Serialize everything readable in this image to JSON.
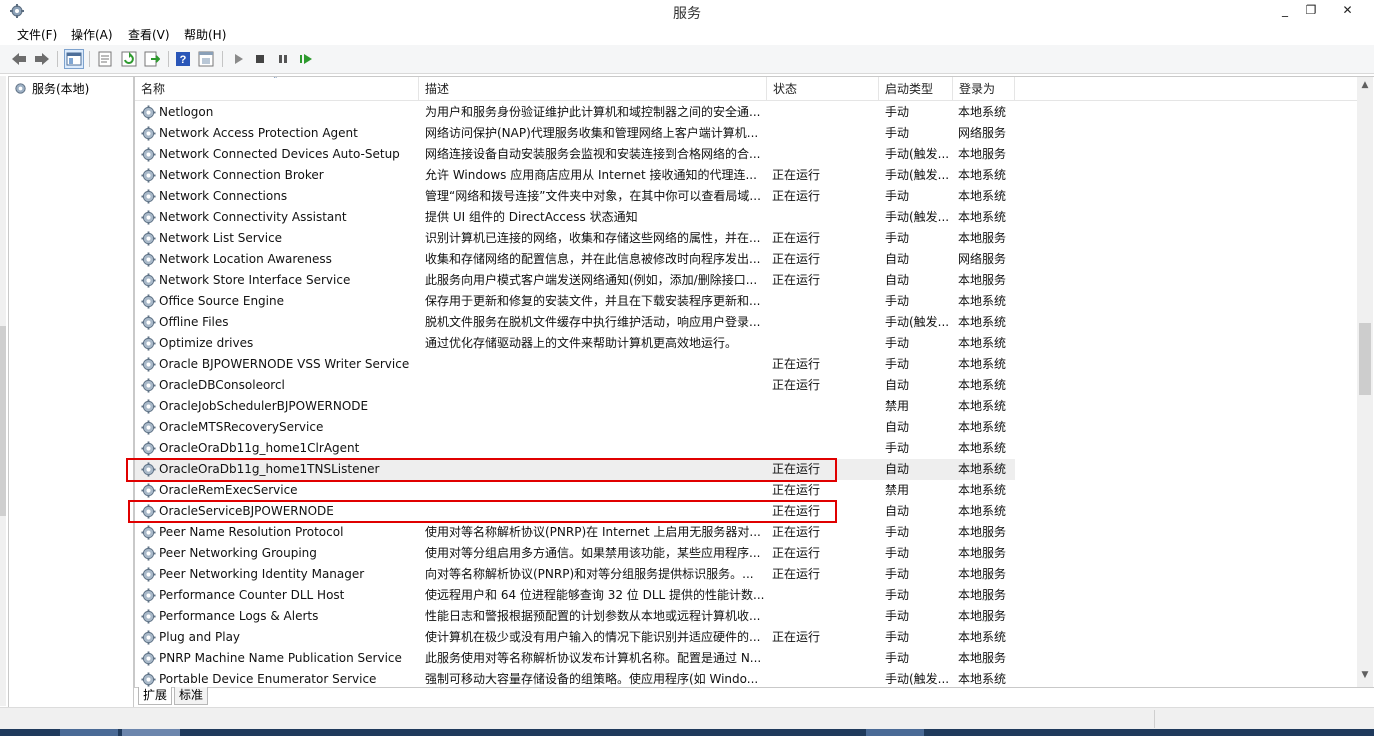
{
  "window": {
    "title": "服务",
    "minimize": "_",
    "maximize": "❐",
    "close": "✕"
  },
  "menu": [
    {
      "label": "文件(F)"
    },
    {
      "label": "操作(A)"
    },
    {
      "label": "查看(V)"
    },
    {
      "label": "帮助(H)"
    }
  ],
  "toolbar_icons": [
    "back-icon",
    "forward-icon",
    "show-console-tree-icon",
    "properties-icon",
    "refresh-icon",
    "export-list-icon",
    "help-icon",
    "view-icon",
    "start-service-icon",
    "stop-service-icon",
    "pause-service-icon",
    "restart-service-icon"
  ],
  "tree": {
    "root_label": "服务(本地)"
  },
  "columns": {
    "name": "名称",
    "description": "描述",
    "status": "状态",
    "startup": "启动类型",
    "logon": "登录为"
  },
  "services": [
    {
      "name": "Netlogon",
      "description": "为用户和服务身份验证维护此计算机和域控制器之间的安全通...",
      "status": "",
      "startup": "手动",
      "logon": "本地系统"
    },
    {
      "name": "Network Access Protection Agent",
      "description": "网络访问保护(NAP)代理服务收集和管理网络上客户端计算机...",
      "status": "",
      "startup": "手动",
      "logon": "网络服务"
    },
    {
      "name": "Network Connected Devices Auto-Setup",
      "description": "网络连接设备自动安装服务会监视和安装连接到合格网络的合...",
      "status": "",
      "startup": "手动(触发...",
      "logon": "本地服务"
    },
    {
      "name": "Network Connection Broker",
      "description": "允许 Windows 应用商店应用从 Internet 接收通知的代理连...",
      "status": "正在运行",
      "startup": "手动(触发...",
      "logon": "本地系统"
    },
    {
      "name": "Network Connections",
      "description": "管理“网络和拨号连接”文件夹中对象，在其中你可以查看局域...",
      "status": "正在运行",
      "startup": "手动",
      "logon": "本地系统"
    },
    {
      "name": "Network Connectivity Assistant",
      "description": "提供 UI 组件的 DirectAccess 状态通知",
      "status": "",
      "startup": "手动(触发...",
      "logon": "本地系统"
    },
    {
      "name": "Network List Service",
      "description": "识别计算机已连接的网络，收集和存储这些网络的属性，并在...",
      "status": "正在运行",
      "startup": "手动",
      "logon": "本地服务"
    },
    {
      "name": "Network Location Awareness",
      "description": "收集和存储网络的配置信息，并在此信息被修改时向程序发出...",
      "status": "正在运行",
      "startup": "自动",
      "logon": "网络服务"
    },
    {
      "name": "Network Store Interface Service",
      "description": "此服务向用户模式客户端发送网络通知(例如，添加/删除接口...",
      "status": "正在运行",
      "startup": "自动",
      "logon": "本地服务"
    },
    {
      "name": "Office  Source Engine",
      "description": "保存用于更新和修复的安装文件，并且在下载安装程序更新和...",
      "status": "",
      "startup": "手动",
      "logon": "本地系统"
    },
    {
      "name": "Offline Files",
      "description": "脱机文件服务在脱机文件缓存中执行维护活动，响应用户登录...",
      "status": "",
      "startup": "手动(触发...",
      "logon": "本地系统"
    },
    {
      "name": "Optimize drives",
      "description": "通过优化存储驱动器上的文件来帮助计算机更高效地运行。",
      "status": "",
      "startup": "手动",
      "logon": "本地系统"
    },
    {
      "name": "Oracle BJPOWERNODE VSS Writer Service",
      "description": "",
      "status": "正在运行",
      "startup": "手动",
      "logon": "本地系统"
    },
    {
      "name": "OracleDBConsoleorcl",
      "description": "",
      "status": "正在运行",
      "startup": "自动",
      "logon": "本地系统"
    },
    {
      "name": "OracleJobSchedulerBJPOWERNODE",
      "description": "",
      "status": "",
      "startup": "禁用",
      "logon": "本地系统"
    },
    {
      "name": "OracleMTSRecoveryService",
      "description": "",
      "status": "",
      "startup": "自动",
      "logon": "本地系统"
    },
    {
      "name": "OracleOraDb11g_home1ClrAgent",
      "description": "",
      "status": "",
      "startup": "手动",
      "logon": "本地系统"
    },
    {
      "name": "OracleOraDb11g_home1TNSListener",
      "description": "",
      "status": "正在运行",
      "startup": "自动",
      "logon": "本地系统",
      "highlight": true
    },
    {
      "name": "OracleRemExecService",
      "description": "",
      "status": "正在运行",
      "startup": "禁用",
      "logon": "本地系统"
    },
    {
      "name": "OracleServiceBJPOWERNODE",
      "description": "",
      "status": "正在运行",
      "startup": "自动",
      "logon": "本地系统"
    },
    {
      "name": "Peer Name Resolution Protocol",
      "description": "使用对等名称解析协议(PNRP)在 Internet 上启用无服务器对...",
      "status": "正在运行",
      "startup": "手动",
      "logon": "本地服务"
    },
    {
      "name": "Peer Networking Grouping",
      "description": "使用对等分组启用多方通信。如果禁用该功能，某些应用程序...",
      "status": "正在运行",
      "startup": "手动",
      "logon": "本地服务"
    },
    {
      "name": "Peer Networking Identity Manager",
      "description": "向对等名称解析协议(PNRP)和对等分组服务提供标识服务。...",
      "status": "正在运行",
      "startup": "手动",
      "logon": "本地服务"
    },
    {
      "name": "Performance Counter DLL Host",
      "description": "使远程用户和 64 位进程能够查询 32 位 DLL 提供的性能计数...",
      "status": "",
      "startup": "手动",
      "logon": "本地服务"
    },
    {
      "name": "Performance Logs & Alerts",
      "description": "性能日志和警报根据预配置的计划参数从本地或远程计算机收...",
      "status": "",
      "startup": "手动",
      "logon": "本地服务"
    },
    {
      "name": "Plug and Play",
      "description": "使计算机在极少或没有用户输入的情况下能识别并适应硬件的...",
      "status": "正在运行",
      "startup": "手动",
      "logon": "本地系统"
    },
    {
      "name": "PNRP Machine Name Publication Service",
      "description": "此服务使用对等名称解析协议发布计算机名称。配置是通过 N...",
      "status": "",
      "startup": "手动",
      "logon": "本地服务"
    },
    {
      "name": "Portable Device Enumerator Service",
      "description": "强制可移动大容量存储设备的组策略。使应用程序(如 Windo...",
      "status": "",
      "startup": "手动(触发...",
      "logon": "本地系统"
    }
  ],
  "tabs": [
    {
      "label": "扩展"
    },
    {
      "label": "标准"
    }
  ],
  "colors": {
    "highlight_box": "#e00000",
    "selected_row": "#eeeeee"
  }
}
